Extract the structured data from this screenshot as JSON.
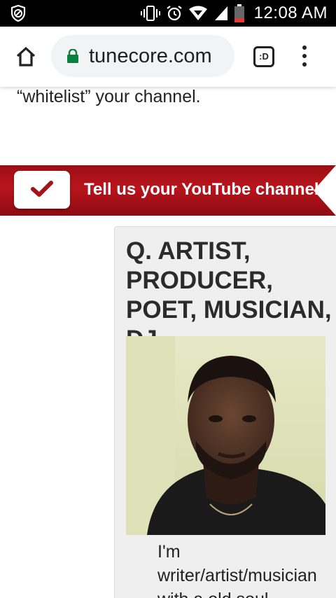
{
  "status_bar": {
    "time": "12:08 AM",
    "left_icon": "block-icon",
    "icons": [
      "vibrate-icon",
      "alarm-icon",
      "wifi-icon",
      "signal-icon",
      "battery-icon"
    ]
  },
  "toolbar": {
    "url_prefix": "",
    "url_domain": "tunecore.com",
    "tab_switcher_label": ":D",
    "secure_color": "#0b8043"
  },
  "page": {
    "paragraph_tail": "“whitelist” your channel.",
    "banner": {
      "text": "Tell us your YouTube channel",
      "background": "#b0141b",
      "check_color": "#a5121a"
    },
    "card": {
      "title": "Q. ARTIST, PRODUCER, POET, MUSICIAN, DJ",
      "body_lines": [
        "I'm",
        "writer/artist/musician",
        "with a old soul"
      ]
    }
  }
}
